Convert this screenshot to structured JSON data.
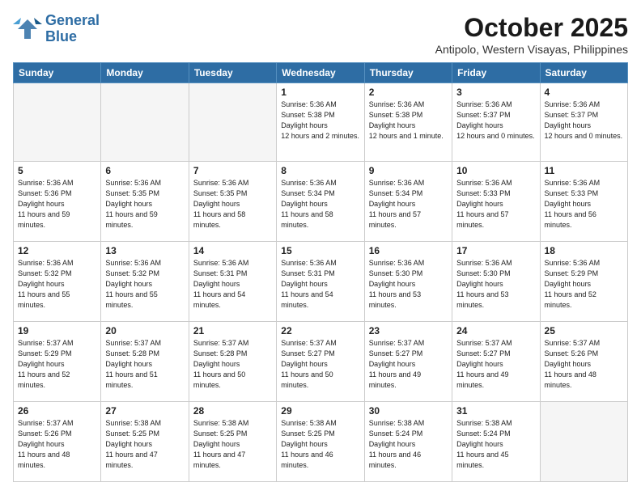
{
  "header": {
    "logo_line1": "General",
    "logo_line2": "Blue",
    "month": "October 2025",
    "location": "Antipolo, Western Visayas, Philippines"
  },
  "weekdays": [
    "Sunday",
    "Monday",
    "Tuesday",
    "Wednesday",
    "Thursday",
    "Friday",
    "Saturday"
  ],
  "weeks": [
    [
      {
        "day": "",
        "empty": true
      },
      {
        "day": "",
        "empty": true
      },
      {
        "day": "",
        "empty": true
      },
      {
        "day": "1",
        "sunrise": "5:36 AM",
        "sunset": "5:38 PM",
        "daylight": "12 hours and 2 minutes."
      },
      {
        "day": "2",
        "sunrise": "5:36 AM",
        "sunset": "5:38 PM",
        "daylight": "12 hours and 1 minute."
      },
      {
        "day": "3",
        "sunrise": "5:36 AM",
        "sunset": "5:37 PM",
        "daylight": "12 hours and 0 minutes."
      },
      {
        "day": "4",
        "sunrise": "5:36 AM",
        "sunset": "5:37 PM",
        "daylight": "12 hours and 0 minutes."
      }
    ],
    [
      {
        "day": "5",
        "sunrise": "5:36 AM",
        "sunset": "5:36 PM",
        "daylight": "11 hours and 59 minutes."
      },
      {
        "day": "6",
        "sunrise": "5:36 AM",
        "sunset": "5:35 PM",
        "daylight": "11 hours and 59 minutes."
      },
      {
        "day": "7",
        "sunrise": "5:36 AM",
        "sunset": "5:35 PM",
        "daylight": "11 hours and 58 minutes."
      },
      {
        "day": "8",
        "sunrise": "5:36 AM",
        "sunset": "5:34 PM",
        "daylight": "11 hours and 58 minutes."
      },
      {
        "day": "9",
        "sunrise": "5:36 AM",
        "sunset": "5:34 PM",
        "daylight": "11 hours and 57 minutes."
      },
      {
        "day": "10",
        "sunrise": "5:36 AM",
        "sunset": "5:33 PM",
        "daylight": "11 hours and 57 minutes."
      },
      {
        "day": "11",
        "sunrise": "5:36 AM",
        "sunset": "5:33 PM",
        "daylight": "11 hours and 56 minutes."
      }
    ],
    [
      {
        "day": "12",
        "sunrise": "5:36 AM",
        "sunset": "5:32 PM",
        "daylight": "11 hours and 55 minutes."
      },
      {
        "day": "13",
        "sunrise": "5:36 AM",
        "sunset": "5:32 PM",
        "daylight": "11 hours and 55 minutes."
      },
      {
        "day": "14",
        "sunrise": "5:36 AM",
        "sunset": "5:31 PM",
        "daylight": "11 hours and 54 minutes."
      },
      {
        "day": "15",
        "sunrise": "5:36 AM",
        "sunset": "5:31 PM",
        "daylight": "11 hours and 54 minutes."
      },
      {
        "day": "16",
        "sunrise": "5:36 AM",
        "sunset": "5:30 PM",
        "daylight": "11 hours and 53 minutes."
      },
      {
        "day": "17",
        "sunrise": "5:36 AM",
        "sunset": "5:30 PM",
        "daylight": "11 hours and 53 minutes."
      },
      {
        "day": "18",
        "sunrise": "5:36 AM",
        "sunset": "5:29 PM",
        "daylight": "11 hours and 52 minutes."
      }
    ],
    [
      {
        "day": "19",
        "sunrise": "5:37 AM",
        "sunset": "5:29 PM",
        "daylight": "11 hours and 52 minutes."
      },
      {
        "day": "20",
        "sunrise": "5:37 AM",
        "sunset": "5:28 PM",
        "daylight": "11 hours and 51 minutes."
      },
      {
        "day": "21",
        "sunrise": "5:37 AM",
        "sunset": "5:28 PM",
        "daylight": "11 hours and 50 minutes."
      },
      {
        "day": "22",
        "sunrise": "5:37 AM",
        "sunset": "5:27 PM",
        "daylight": "11 hours and 50 minutes."
      },
      {
        "day": "23",
        "sunrise": "5:37 AM",
        "sunset": "5:27 PM",
        "daylight": "11 hours and 49 minutes."
      },
      {
        "day": "24",
        "sunrise": "5:37 AM",
        "sunset": "5:27 PM",
        "daylight": "11 hours and 49 minutes."
      },
      {
        "day": "25",
        "sunrise": "5:37 AM",
        "sunset": "5:26 PM",
        "daylight": "11 hours and 48 minutes."
      }
    ],
    [
      {
        "day": "26",
        "sunrise": "5:37 AM",
        "sunset": "5:26 PM",
        "daylight": "11 hours and 48 minutes."
      },
      {
        "day": "27",
        "sunrise": "5:38 AM",
        "sunset": "5:25 PM",
        "daylight": "11 hours and 47 minutes."
      },
      {
        "day": "28",
        "sunrise": "5:38 AM",
        "sunset": "5:25 PM",
        "daylight": "11 hours and 47 minutes."
      },
      {
        "day": "29",
        "sunrise": "5:38 AM",
        "sunset": "5:25 PM",
        "daylight": "11 hours and 46 minutes."
      },
      {
        "day": "30",
        "sunrise": "5:38 AM",
        "sunset": "5:24 PM",
        "daylight": "11 hours and 46 minutes."
      },
      {
        "day": "31",
        "sunrise": "5:38 AM",
        "sunset": "5:24 PM",
        "daylight": "11 hours and 45 minutes."
      },
      {
        "day": "",
        "empty": true
      }
    ]
  ]
}
